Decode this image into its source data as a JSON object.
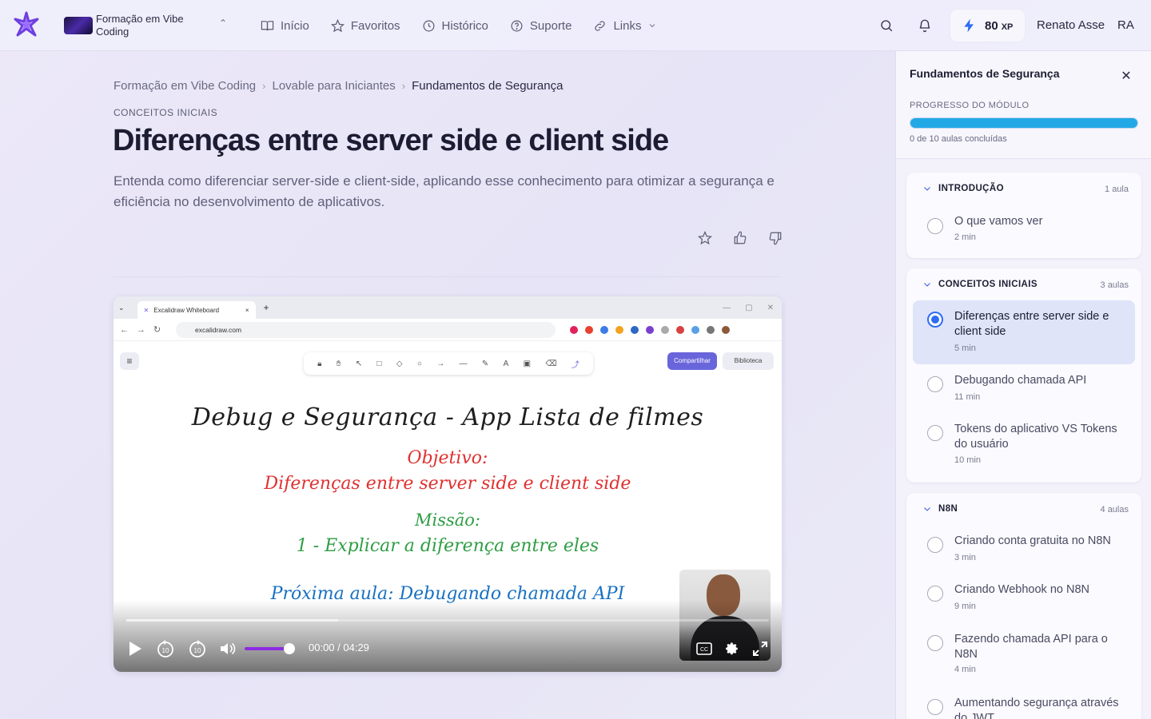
{
  "header": {
    "course_name": "Formação em Vibe Coding",
    "nav": [
      {
        "label": "Início",
        "icon": "book-icon"
      },
      {
        "label": "Favoritos",
        "icon": "star-icon"
      },
      {
        "label": "Histórico",
        "icon": "history-icon"
      },
      {
        "label": "Suporte",
        "icon": "help-icon"
      },
      {
        "label": "Links",
        "icon": "link-icon"
      }
    ],
    "xp_value": "80",
    "xp_unit": "XP",
    "user_name": "Renato Asse",
    "user_initials": "RA"
  },
  "breadcrumb": [
    "Formação em Vibe Coding",
    "Lovable para Iniciantes",
    "Fundamentos de Segurança"
  ],
  "lesson": {
    "section": "CONCEITOS INICIAIS",
    "title": "Diferenças entre server side e client side",
    "description": "Entenda como diferenciar server-side e client-side, aplicando esse conhecimento para otimizar a segurança e eficiência no desenvolvimento de aplicativos."
  },
  "video": {
    "browser_tab": "Excalidraw Whiteboard",
    "browser_url": "excalidraw.com",
    "share_label": "Compartilhar",
    "library_label": "Biblioteca",
    "board_title": "Debug e Segurança - App Lista de filmes",
    "board_objective_label": "Objetivo:",
    "board_objective": "Diferenças entre server side e client side",
    "board_mission_label": "Missão:",
    "board_mission": "1 - Explicar a diferença entre eles",
    "board_next": "Próxima aula: Debugando chamada API",
    "time_display": "00:00 / 04:29",
    "buffered_fraction": 0.33,
    "volume_fraction": 0.9,
    "skip_seconds": "10"
  },
  "sidebar": {
    "title": "Fundamentos de Segurança",
    "progress_label": "PROGRESSO DO MÓDULO",
    "progress_text": "0 de 10 aulas concluídas",
    "modules": [
      {
        "name": "INTRODUÇÃO",
        "count": "1 aula",
        "lessons": [
          {
            "title": "O que vamos ver",
            "duration": "2 min",
            "active": false
          }
        ]
      },
      {
        "name": "CONCEITOS INICIAIS",
        "count": "3 aulas",
        "lessons": [
          {
            "title": "Diferenças entre server side e client side",
            "duration": "5 min",
            "active": true
          },
          {
            "title": "Debugando chamada API",
            "duration": "11 min",
            "active": false
          },
          {
            "title": "Tokens do aplicativo VS Tokens do usuário",
            "duration": "10 min",
            "active": false
          }
        ]
      },
      {
        "name": "N8N",
        "count": "4 aulas",
        "lessons": [
          {
            "title": "Criando conta gratuita no N8N",
            "duration": "3 min",
            "active": false
          },
          {
            "title": "Criando Webhook no N8N",
            "duration": "9 min",
            "active": false
          },
          {
            "title": "Fazendo chamada API para o N8N",
            "duration": "4 min",
            "active": false
          },
          {
            "title": "Aumentando segurança através do JWT",
            "duration": "",
            "active": false
          }
        ]
      }
    ]
  }
}
